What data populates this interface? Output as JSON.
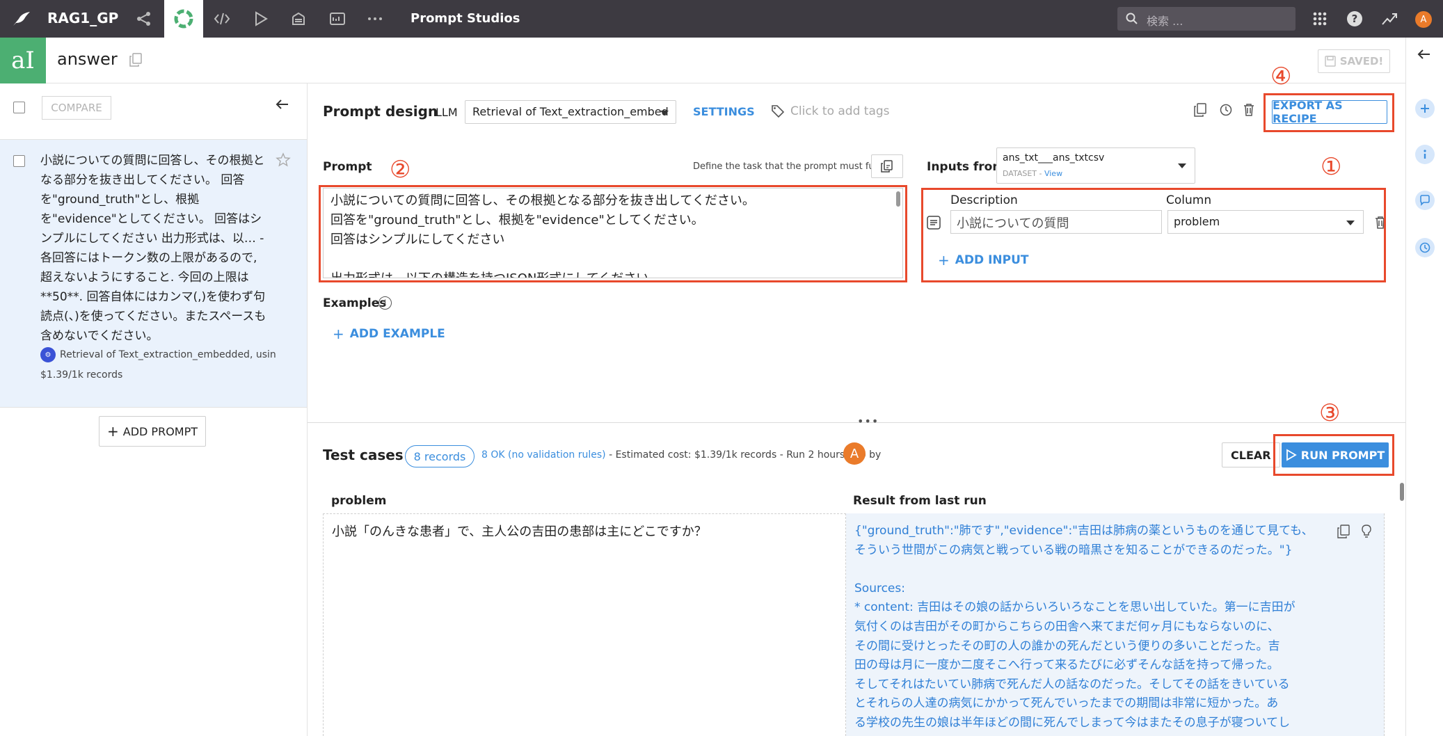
{
  "topnav": {
    "project": "RAG1_GP",
    "studio_title": "Prompt Studios",
    "search_placeholder": "検索 ...",
    "avatar_letter": "A",
    "icons": [
      "bird-logo-icon",
      "flow-icon",
      "recipe-icon",
      "code-icon",
      "play-icon",
      "database-icon",
      "dashboard-icon",
      "more-icon",
      "grid-icon",
      "help-icon",
      "activity-icon"
    ]
  },
  "header": {
    "logo": "aI",
    "title": "answer",
    "saved_label": "SAVED!"
  },
  "left": {
    "compare_label": "COMPARE",
    "prompt_item": {
      "text": "小説についての質問に回答し、その根拠となる部分を抜き出してください。 回答を\"ground_truth\"とし、根拠を\"evidence\"としてください。 回答はシンプルにしてください 出力形式は、以… - 各回答にはトークン数の上限があるので, 超えないようにすること. 今回の上限は**50**. 回答自体にはカンマ(,)を使わず句読点(、)を使ってください。またスペースも含めないでください。",
      "llm": "Retrieval of Text_extraction_embedded, usin...",
      "cost": "$1.39/1k records"
    },
    "add_prompt_label": "ADD PROMPT"
  },
  "design": {
    "title": "Prompt design",
    "llm_label": "LLM",
    "llm_value": "Retrieval of Text_extraction_embed",
    "settings_label": "SETTINGS",
    "tags_placeholder": "Click to add tags",
    "export_label": "EXPORT AS RECIPE",
    "prompt_label": "Prompt",
    "define_hint": "Define the task that the prompt must fulfill",
    "prompt_lines": [
      "小説についての質問に回答し、その根拠となる部分を抜き出してください。",
      "回答を\"ground_truth\"とし、根拠を\"evidence\"としてください。",
      "回答はシンプルにしてください",
      "",
      "出力形式は、以下の構造を持つJSON形式にしてください"
    ],
    "examples_label": "Examples",
    "add_example_label": "ADD EXAMPLE",
    "inputs_from_label": "Inputs from",
    "dataset_name": "ans_txt___ans_txtcsv",
    "dataset_type": "DATASET",
    "dataset_view": "View",
    "description_label": "Description",
    "column_label": "Column",
    "description_value": "小説についての質問",
    "column_value": "problem",
    "add_input_label": "ADD INPUT"
  },
  "markers": [
    "④",
    "②",
    "①",
    "③"
  ],
  "tests": {
    "title": "Test cases",
    "records": "8 records",
    "ok_text": "8 OK (no validation rules)",
    "rest_text": " - Estimated cost: $1.39/1k records - Run 2 hours ago  by",
    "avatar_letter": "A",
    "clear_label": "CLEAR",
    "run_label": "RUN PROMPT",
    "col_problem": "problem",
    "col_result": "Result from last run",
    "row_problem": "小説「のんきな患者」で、主人公の吉田の患部は主にどこですか？",
    "result_lines": [
      "{\"ground_truth\":\"肺です\",\"evidence\":\"吉田は肺病の薬というものを通じて見ても、",
      "そういう世間がこの病気と戦っている戦の暗黒さを知ることができるのだった。\"}",
      "",
      "Sources:",
      "* content: 吉田はその娘の話からいろいろなことを思い出していた。第一に吉田が",
      "気付くのは吉田がその町からこちらの田舎へ来てまだ何ヶ月にもならないのに、",
      "その間に受けとったその町の人の誰かの死んだという便りの多いことだった。吉",
      "田の母は月に一度か二度そこへ行って来るたびに必ずそんな話を持って帰った。",
      "そしてそれはたいてい肺病で死んだ人の話なのだった。そしてその話をきいている",
      "とそれらの人達の病気にかかって死んでいったまでの期間は非常に短かった。あ",
      "る学校の先生の娘は半年ほどの間に死んでしまって今はまたその息子が寝ついてし"
    ]
  },
  "colors": {
    "nav_bg": "#3d3a41",
    "accent": "#3b8ede",
    "logo_green": "#4caf72",
    "annotation_red": "#e8492c",
    "avatar_orange": "#ea7b2a"
  }
}
